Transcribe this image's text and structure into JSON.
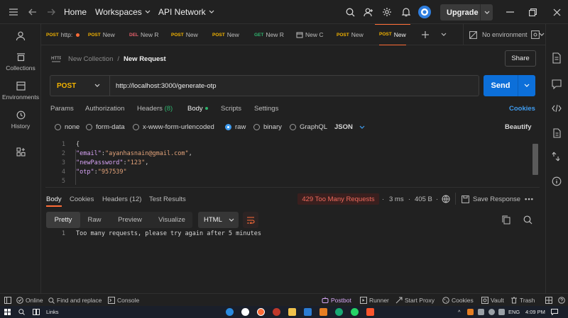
{
  "titlebar": {
    "nav": {
      "home": "Home",
      "workspaces": "Workspaces",
      "api_network": "API Network"
    },
    "upgrade_label": "Upgrade"
  },
  "left_sidebar": {
    "items": [
      {
        "label": "Collections"
      },
      {
        "label": "Environments"
      },
      {
        "label": "History"
      }
    ]
  },
  "tabs": [
    {
      "method": "POST",
      "name": "http:",
      "unsaved": true,
      "method_color": "#f4b400"
    },
    {
      "method": "POST",
      "name": "New",
      "method_color": "#f4b400"
    },
    {
      "method": "DEL",
      "name": "New R",
      "method_color": "#e6606b"
    },
    {
      "method": "POST",
      "name": "New",
      "method_color": "#f4b400"
    },
    {
      "method": "POST",
      "name": "New",
      "method_color": "#f4b400"
    },
    {
      "method": "GET",
      "name": "New R",
      "method_color": "#2fb36e"
    },
    {
      "method": "",
      "name": "New C"
    },
    {
      "method": "POST",
      "name": "New",
      "method_color": "#f4b400"
    },
    {
      "method": "POST",
      "name": "New",
      "method_color": "#f4b400",
      "active": true
    }
  ],
  "environment": "No environment",
  "breadcrumb": {
    "collection": "New Collection",
    "separator": "/",
    "request": "New Request"
  },
  "share_label": "Share",
  "request": {
    "method": "POST",
    "url": "http://localhost:3000/generate-otp",
    "send_label": "Send"
  },
  "request_tabs": {
    "params": "Params",
    "authorization": "Authorization",
    "headers": "Headers",
    "headers_count": "(8)",
    "body": "Body",
    "scripts": "Scripts",
    "settings": "Settings",
    "cookies": "Cookies"
  },
  "body_types": {
    "none": "none",
    "form_data": "form-data",
    "urlencoded": "x-www-form-urlencoded",
    "raw": "raw",
    "binary": "binary",
    "graphql": "GraphQL",
    "selected_format": "JSON",
    "beautify": "Beautify"
  },
  "request_body_lines": [
    {
      "num": "1",
      "text": "{"
    },
    {
      "num": "2",
      "key": "\"email\"",
      "value": "\"ayanhasnain@gmail.com\"",
      "trail": ","
    },
    {
      "num": "3",
      "key": "\"newPassword\"",
      "value": "\"123\"",
      "trail": ","
    },
    {
      "num": "4",
      "key": "\"otp\"",
      "value": "\"957539\"",
      "trail": ""
    },
    {
      "num": "5",
      "text": ""
    }
  ],
  "response": {
    "tabs": {
      "body": "Body",
      "cookies": "Cookies",
      "headers": "Headers (12)",
      "test_results": "Test Results"
    },
    "status": "429 Too Many Requests",
    "status_color": "#f06a5c",
    "time": "3 ms",
    "size": "405 B",
    "save_label": "Save Response",
    "views": {
      "pretty": "Pretty",
      "raw": "Raw",
      "preview": "Preview",
      "visualize": "Visualize"
    },
    "format": "HTML",
    "line_num": "1",
    "body_text": "Too many requests, please try again after 5 minutes"
  },
  "statusbar": {
    "online": "Online",
    "find_replace": "Find and replace",
    "console": "Console",
    "postbot": "Postbot",
    "runner": "Runner",
    "start_proxy": "Start Proxy",
    "cookies": "Cookies",
    "vault": "Vault",
    "trash": "Trash"
  },
  "taskbar": {
    "links": "Links",
    "language": "ENG",
    "time": "4:09 PM"
  },
  "colors": {
    "accent": "#ff6c37",
    "send": "#0c6fd9",
    "link": "#3f9cf0"
  }
}
